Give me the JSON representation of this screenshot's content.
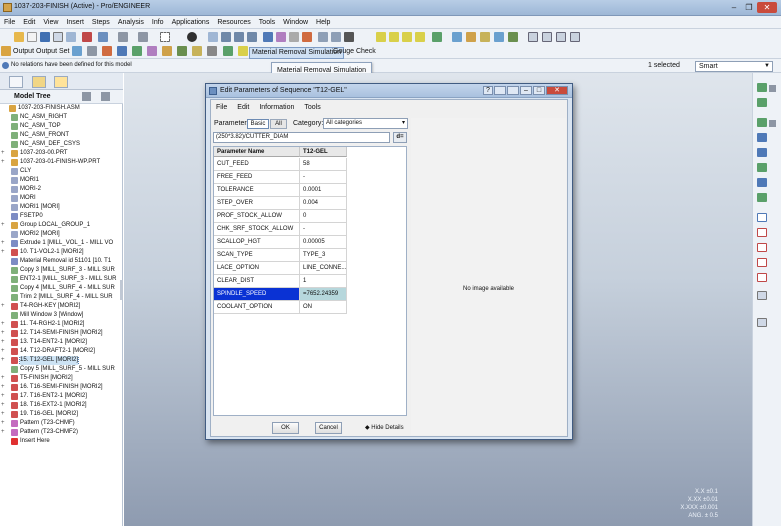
{
  "window": {
    "title": "1037-203-FINISH (Active) - Pro/ENGINEER",
    "controls": [
      "–",
      "❐",
      "✕"
    ]
  },
  "menu": [
    "File",
    "Edit",
    "View",
    "Insert",
    "Steps",
    "Analysis",
    "Info",
    "Applications",
    "Resources",
    "Tools",
    "Window",
    "Help"
  ],
  "toolbar2": {
    "output": "Output",
    "output_set": "Output Set",
    "mrs": "Material Removal Simulation",
    "gouge": "Gouge Check"
  },
  "status": {
    "message": "No relations have been defined for this model",
    "selected": "1 selected",
    "filter": "Smart"
  },
  "tooltip": "Material Removal Simulation",
  "model_tree": {
    "title": "Model Tree",
    "items": [
      {
        "label": "1037-203-FINISH.ASM",
        "indent": 0,
        "exp": "",
        "color": "#d9a441"
      },
      {
        "label": "NC_ASM_RIGHT",
        "indent": 1,
        "exp": "",
        "color": "#7fb07a"
      },
      {
        "label": "NC_ASM_TOP",
        "indent": 1,
        "exp": "",
        "color": "#7fb07a"
      },
      {
        "label": "NC_ASM_FRONT",
        "indent": 1,
        "exp": "",
        "color": "#7fb07a"
      },
      {
        "label": "NC_ASM_DEF_CSYS",
        "indent": 1,
        "exp": "",
        "color": "#7fb07a"
      },
      {
        "label": "1037-203-00.PRT",
        "indent": 1,
        "exp": "+",
        "color": "#d9a441"
      },
      {
        "label": "1037-203-01-FINISH-WP.PRT",
        "indent": 1,
        "exp": "+",
        "color": "#d9a441"
      },
      {
        "label": "CLY",
        "indent": 1,
        "exp": "",
        "color": "#9aa6c8"
      },
      {
        "label": "MORI1",
        "indent": 1,
        "exp": "",
        "color": "#9aa6c8"
      },
      {
        "label": "MORI-2",
        "indent": 1,
        "exp": "",
        "color": "#9aa6c8"
      },
      {
        "label": "MORI",
        "indent": 1,
        "exp": "",
        "color": "#9aa6c8"
      },
      {
        "label": "MORI1 [MORI]",
        "indent": 1,
        "exp": "",
        "color": "#9aa6c8"
      },
      {
        "label": "FSETP0",
        "indent": 1,
        "exp": "",
        "color": "#7d8cc4"
      },
      {
        "label": "Group LOCAL_GROUP_1",
        "indent": 1,
        "exp": "+",
        "color": "#d9a441"
      },
      {
        "label": "MORI2 [MORI]",
        "indent": 1,
        "exp": "",
        "color": "#9aa6c8"
      },
      {
        "label": "Extrude 1 [MILL_VOL_1 - MILL VO",
        "indent": 1,
        "exp": "+",
        "color": "#7d8cc4"
      },
      {
        "label": "10. T1-VOL2-1 [MORI2]",
        "indent": 1,
        "exp": "+",
        "color": "#d05050"
      },
      {
        "label": "Material Removal id 51101 [10. T1",
        "indent": 1,
        "exp": "",
        "color": "#7d8cc4"
      },
      {
        "label": "Copy 3 [MILL_SURF_3 - MILL SUR",
        "indent": 1,
        "exp": "",
        "color": "#7fb07a"
      },
      {
        "label": "ENT2-1 [MILL_SURF_3 - MILL SUR",
        "indent": 1,
        "exp": "",
        "color": "#7fb07a"
      },
      {
        "label": "Copy 4 [MILL_SURF_4 - MILL SUR",
        "indent": 1,
        "exp": "",
        "color": "#7fb07a"
      },
      {
        "label": "Trim 2 [MILL_SURF_4 - MILL SUR",
        "indent": 1,
        "exp": "",
        "color": "#7fb07a"
      },
      {
        "label": "T4-RGH-KEY [MORI2]",
        "indent": 1,
        "exp": "+",
        "color": "#d05050"
      },
      {
        "label": "Mill Window 3 [Window]",
        "indent": 1,
        "exp": "",
        "color": "#7fb07a"
      },
      {
        "label": "11. T4-RGH2-1 [MORI2]",
        "indent": 1,
        "exp": "+",
        "color": "#d05050"
      },
      {
        "label": "12. T14-SEMI-FINISH [MORI2]",
        "indent": 1,
        "exp": "+",
        "color": "#d05050"
      },
      {
        "label": "13. T14-ENT2-1 [MORI2]",
        "indent": 1,
        "exp": "+",
        "color": "#d05050"
      },
      {
        "label": "14. T12-DRAFT2-1 [MORI2]",
        "indent": 1,
        "exp": "+",
        "color": "#d05050"
      },
      {
        "label": "15. T12-GEL [MORI2]",
        "indent": 1,
        "exp": "+",
        "color": "#d05050",
        "selected": true
      },
      {
        "label": "Copy 5 [MILL_SURF_5 - MILL SUR",
        "indent": 1,
        "exp": "",
        "color": "#7fb07a"
      },
      {
        "label": "T5-FINISH [MORI2]",
        "indent": 1,
        "exp": "+",
        "color": "#d05050"
      },
      {
        "label": "16. T16-SEMI-FINISH [MORI2]",
        "indent": 1,
        "exp": "+",
        "color": "#d05050"
      },
      {
        "label": "17. T16-ENT2-1 [MORI2]",
        "indent": 1,
        "exp": "+",
        "color": "#d05050"
      },
      {
        "label": "18. T16-EXT2-1 [MORI2]",
        "indent": 1,
        "exp": "+",
        "color": "#d05050"
      },
      {
        "label": "19. T16-GEL [MORI2]",
        "indent": 1,
        "exp": "+",
        "color": "#d05050"
      },
      {
        "label": "Pattern (T23-CHMF)",
        "indent": 1,
        "exp": "+",
        "color": "#c46bbf"
      },
      {
        "label": "Pattern (T23-CHMF2)",
        "indent": 1,
        "exp": "+",
        "color": "#c46bbf"
      },
      {
        "label": "Insert Here",
        "indent": 1,
        "exp": "",
        "color": "#e03030"
      }
    ]
  },
  "dialog": {
    "title": "Edit Parameters of Sequence \"T12-GEL\"",
    "menu": [
      "File",
      "Edit",
      "Information",
      "Tools"
    ],
    "parameters_label": "Parameters",
    "tab_basic": "Basic",
    "tab_all": "All",
    "category_label": "Category:",
    "category_value": "All categories",
    "formula": "(250*3.82)/CUTTER_DIAM",
    "formula_button": "d=",
    "columns": [
      "Parameter Name",
      "T12-GEL"
    ],
    "rows": [
      {
        "name": "CUT_FEED",
        "value": "58"
      },
      {
        "name": "FREE_FEED",
        "value": "-"
      },
      {
        "name": "TOLERANCE",
        "value": "0.0001"
      },
      {
        "name": "STEP_OVER",
        "value": "0.004"
      },
      {
        "name": "PROF_STOCK_ALLOW",
        "value": "0"
      },
      {
        "name": "CHK_SRF_STOCK_ALLOW",
        "value": "-"
      },
      {
        "name": "SCALLOP_HGT",
        "value": "0.00005"
      },
      {
        "name": "SCAN_TYPE",
        "value": "TYPE_3"
      },
      {
        "name": "LACE_OPTION",
        "value": "LINE_CONNE..."
      },
      {
        "name": "CLEAR_DIST",
        "value": "1"
      },
      {
        "name": "SPINDLE_SPEED",
        "value": "=7652.24359",
        "selected": true
      },
      {
        "name": "COOLANT_OPTION",
        "value": "ON"
      }
    ],
    "preview_text": "No image available",
    "ok": "OK",
    "cancel": "Cancel",
    "hide_details": "Hide Details"
  },
  "tolerances": [
    "X.X ±0.1",
    "X.XX ±0.01",
    "X.XXX ±0.001",
    "ANG. ± 0.5"
  ],
  "colors": {
    "accent": "#0a32d4",
    "title_gradient": "#a9c1df",
    "graphics_bottom": "#8e9bb0"
  }
}
